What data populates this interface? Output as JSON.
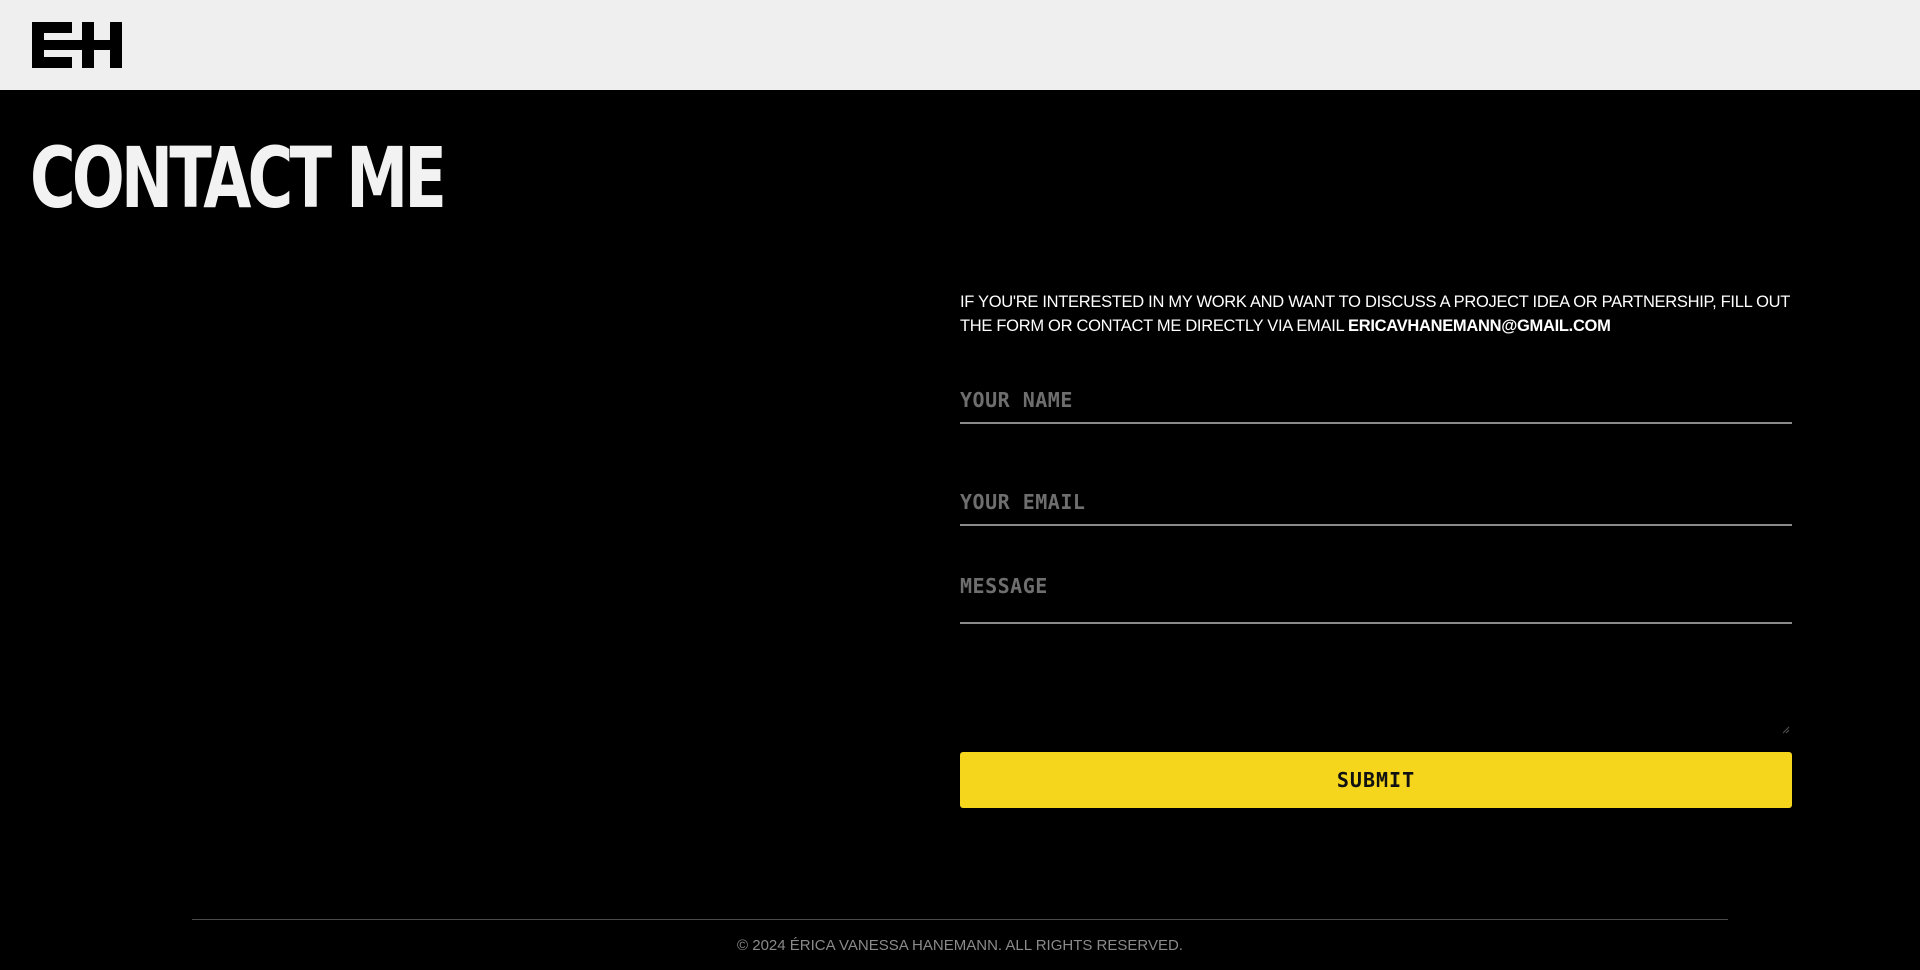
{
  "header": {
    "logo_text": "EH",
    "logo_icon": "eh-monogram-logo"
  },
  "main": {
    "title": "CONTACT ME",
    "intro_text": "IF YOU'RE INTERESTED IN MY WORK AND WANT TO DISCUSS A PROJECT IDEA OR PARTNERSHIP, FILL OUT THE FORM OR CONTACT ME DIRECTLY VIA EMAIL ",
    "email": "ERICAVHANEMANN@GMAIL.COM"
  },
  "form": {
    "name_placeholder": "YOUR NAME",
    "name_value": "",
    "email_placeholder": "YOUR EMAIL",
    "email_value": "",
    "message_placeholder": "MESSAGE",
    "message_value": "",
    "submit_label": "SUBMIT"
  },
  "footer": {
    "copyright": "© 2024 ÉRICA VANESSA HANEMANN. ALL RIGHTS RESERVED."
  },
  "colors": {
    "background": "#000000",
    "header_background": "#efefef",
    "accent": "#f5d61d",
    "text": "#ffffff",
    "muted": "#8a8a8a"
  }
}
